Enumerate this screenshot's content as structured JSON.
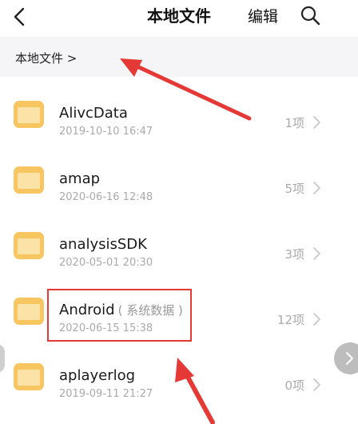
{
  "header": {
    "title": "本地文件",
    "edit_label": "编辑",
    "back_icon": "back-arrow-icon",
    "search_icon": "search-icon"
  },
  "breadcrumb": {
    "text": "本地文件 >"
  },
  "files": [
    {
      "name": "AlivcData",
      "tag": "",
      "date": "2019-10-10 16:47",
      "count": "1项"
    },
    {
      "name": "amap",
      "tag": "",
      "date": "2020-06-16 12:48",
      "count": "5项"
    },
    {
      "name": "analysisSDK",
      "tag": "",
      "date": "2020-05-01 20:30",
      "count": "3项"
    },
    {
      "name": "Android",
      "tag": "( 系统数据 )",
      "date": "2020-06-15 15:38",
      "count": "12项"
    },
    {
      "name": "aplayerlog",
      "tag": "",
      "date": "2019-09-11 21:27",
      "count": "0项"
    }
  ],
  "colors": {
    "folder": "#f7c661",
    "folder_tab": "#f3b94a",
    "annotation": "#e53935",
    "chevron": "#c8c8c8"
  }
}
